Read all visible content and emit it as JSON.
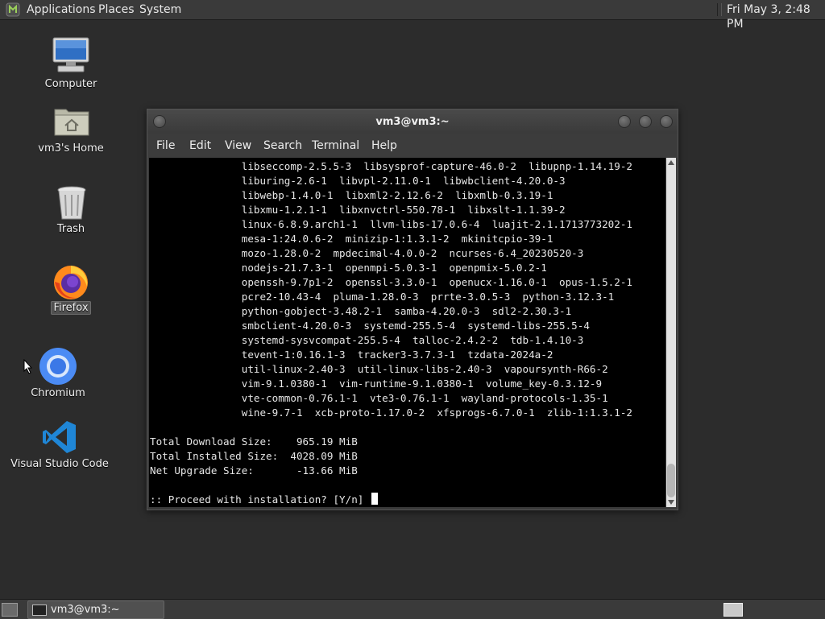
{
  "top_panel": {
    "menu_applications": "Applications",
    "menu_places": "Places",
    "menu_system": "System",
    "clock": "Fri May 3, 2:48 PM"
  },
  "desktop_icons": [
    {
      "label": "Computer",
      "icon": "computer-icon"
    },
    {
      "label": "vm3's Home",
      "icon": "home-folder-icon"
    },
    {
      "label": "Trash",
      "icon": "trash-icon"
    },
    {
      "label": "Firefox",
      "icon": "firefox-icon"
    },
    {
      "label": "Chromium",
      "icon": "chromium-icon"
    },
    {
      "label": "Visual Studio Code",
      "icon": "vscode-icon"
    }
  ],
  "terminal": {
    "title": "vm3@vm3:~",
    "menu": [
      "File",
      "Edit",
      "View",
      "Search",
      "Terminal",
      "Help"
    ],
    "lines": [
      "               libseccomp-2.5.5-3  libsysprof-capture-46.0-2  libupnp-1.14.19-2",
      "               liburing-2.6-1  libvpl-2.11.0-1  libwbclient-4.20.0-3",
      "               libwebp-1.4.0-1  libxml2-2.12.6-2  libxmlb-0.3.19-1",
      "               libxmu-1.2.1-1  libxnvctrl-550.78-1  libxslt-1.1.39-2",
      "               linux-6.8.9.arch1-1  llvm-libs-17.0.6-4  luajit-2.1.1713773202-1",
      "               mesa-1:24.0.6-2  minizip-1:1.3.1-2  mkinitcpio-39-1",
      "               mozo-1.28.0-2  mpdecimal-4.0.0-2  ncurses-6.4_20230520-3",
      "               nodejs-21.7.3-1  openmpi-5.0.3-1  openpmix-5.0.2-1",
      "               openssh-9.7p1-2  openssl-3.3.0-1  openucx-1.16.0-1  opus-1.5.2-1",
      "               pcre2-10.43-4  pluma-1.28.0-3  prrte-3.0.5-3  python-3.12.3-1",
      "               python-gobject-3.48.2-1  samba-4.20.0-3  sdl2-2.30.3-1",
      "               smbclient-4.20.0-3  systemd-255.5-4  systemd-libs-255.5-4",
      "               systemd-sysvcompat-255.5-4  talloc-2.4.2-2  tdb-1.4.10-3",
      "               tevent-1:0.16.1-3  tracker3-3.7.3-1  tzdata-2024a-2",
      "               util-linux-2.40-3  util-linux-libs-2.40-3  vapoursynth-R66-2",
      "               vim-9.1.0380-1  vim-runtime-9.1.0380-1  volume_key-0.3.12-9",
      "               vte-common-0.76.1-1  vte3-0.76.1-1  wayland-protocols-1.35-1",
      "               wine-9.7-1  xcb-proto-1.17.0-2  xfsprogs-6.7.0-1  zlib-1:1.3.1-2",
      "",
      "Total Download Size:    965.19 MiB",
      "Total Installed Size:  4028.09 MiB",
      "Net Upgrade Size:       -13.66 MiB",
      "",
      ":: Proceed with installation? [Y/n] "
    ]
  },
  "taskbar": {
    "window_button_label": "vm3@vm3:~"
  }
}
